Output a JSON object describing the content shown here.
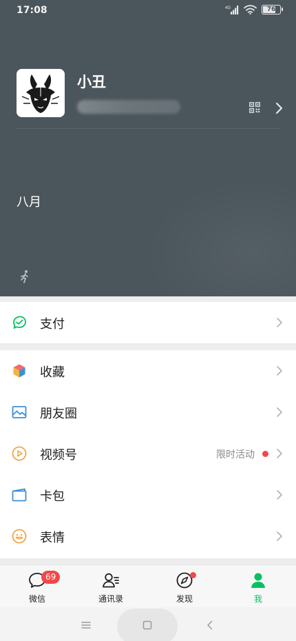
{
  "status_bar": {
    "time": "17:08",
    "network_label": "4G",
    "battery_level": 76,
    "battery_text": "76"
  },
  "profile": {
    "name": "小丑",
    "month": "八月",
    "avatar_icon": "jester-avatar",
    "qr_icon": "qr-code-icon",
    "status_icon": "runner-icon"
  },
  "sections": {
    "pay": [
      {
        "label": "支付",
        "icon": "pay-icon",
        "color": "#07c160"
      }
    ],
    "main": [
      {
        "label": "收藏",
        "icon": "favorites-cube-icon"
      },
      {
        "label": "朋友圈",
        "icon": "moments-image-icon",
        "color": "#3d8fd9"
      },
      {
        "label": "视频号",
        "icon": "channels-play-icon",
        "color": "#f0a445",
        "extra": "限时活动",
        "dot": true
      },
      {
        "label": "卡包",
        "icon": "card-wallet-icon",
        "color": "#3d8fd9"
      },
      {
        "label": "表情",
        "icon": "sticker-smiley-icon",
        "color": "#f0a445"
      }
    ]
  },
  "tabs": [
    {
      "label": "微信",
      "icon": "chat-bubble-icon",
      "badge": "69"
    },
    {
      "label": "通讯录",
      "icon": "contacts-icon"
    },
    {
      "label": "发现",
      "icon": "discover-compass-icon",
      "dot": true
    },
    {
      "label": "我",
      "icon": "me-person-icon",
      "active": true
    }
  ],
  "colors": {
    "header_bg": "#4b565c",
    "accent": "#07c160",
    "badge_red": "#f24848",
    "page_bg": "#ededed"
  }
}
